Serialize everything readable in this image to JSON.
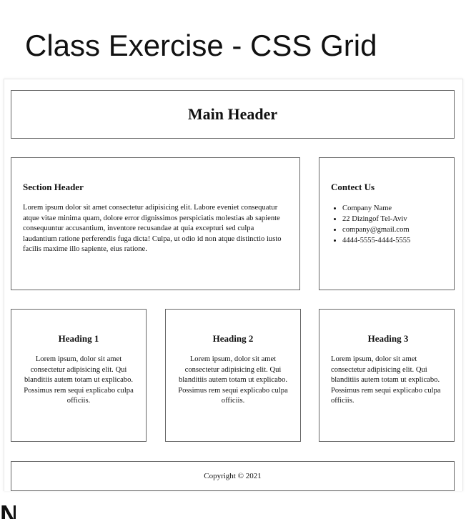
{
  "slide": {
    "title": "Class Exercise - CSS Grid",
    "cut_off_text": "N"
  },
  "page": {
    "main_header": "Main Header",
    "section": {
      "heading": "Section Header",
      "text": "Lorem ipsum dolor sit amet consectetur adipisicing elit. Labore eveniet consequatur atque vitae minima quam, dolore error dignissimos perspiciatis molestias ab sapiente consequuntur accusantium, inventore recusandae at quia excepturi sed culpa laudantium ratione perferendis fuga dicta! Culpa, ut odio id non atque distinctio iusto facilis maxime illo sapiente, eius ratione."
    },
    "contact": {
      "heading": "Contect Us",
      "items": [
        "Company Name",
        "22 Dizingof Tel-Aviv",
        "company@gmail.com",
        "4444-5555-4444-5555"
      ]
    },
    "cards": [
      {
        "heading": "Heading 1",
        "text": "Lorem ipsum, dolor sit amet consectetur adipisicing elit. Qui blanditiis autem totam ut explicabo. Possimus rem sequi explicabo culpa officiis."
      },
      {
        "heading": "Heading 2",
        "text": "Lorem ipsum, dolor sit amet consectetur adipisicing elit. Qui blanditiis autem totam ut explicabo. Possimus rem sequi explicabo culpa officiis."
      },
      {
        "heading": "Heading 3",
        "text": "Lorem ipsum, dolor sit amet consectetur adipisicing elit. Qui blanditiis autem totam ut explicabo. Possimus rem sequi explicabo culpa officiis."
      }
    ],
    "footer": "Copyright © 2021"
  },
  "colors": {
    "border": "#666666",
    "text": "#111111",
    "background": "#ffffff"
  }
}
